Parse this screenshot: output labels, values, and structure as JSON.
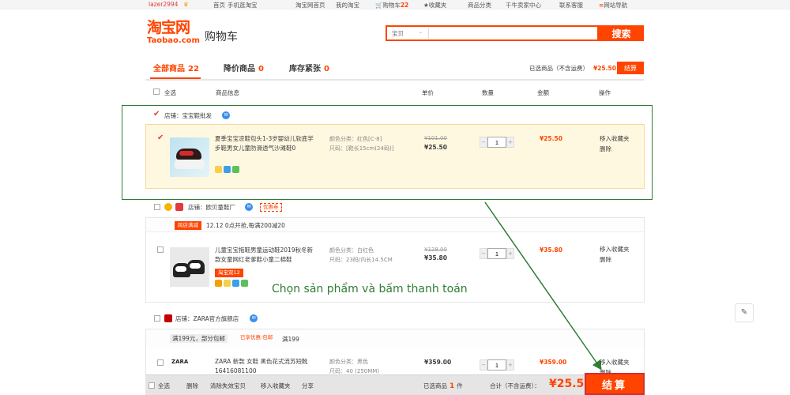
{
  "topbar": {
    "user": "lazer2994",
    "links": [
      "淘宝网首页",
      "我的淘宝",
      "购物车",
      "收藏夹",
      "商品分类",
      "千牛卖家中心",
      "联系客服",
      "网站导航"
    ],
    "mobile": "手机逛淘宝",
    "home": "首页",
    "cart_count": "22"
  },
  "header": {
    "logo_cn": "淘宝网",
    "logo_en": "Taobao.com",
    "cart_title": "购物车",
    "search_scope": "宝贝",
    "search_placeholder": "",
    "search_button": "搜索"
  },
  "tabs": [
    {
      "label": "全部商品",
      "count": "22"
    },
    {
      "label": "降价商品",
      "count": "0"
    },
    {
      "label": "库存紧张",
      "count": "0"
    }
  ],
  "summary": {
    "selected_label": "已选商品（不含运费）",
    "selected_amount": "¥25.50",
    "checkout_small": "结算"
  },
  "columns": {
    "select_all": "全选",
    "info": "商品信息",
    "unit_price": "单价",
    "quantity": "数量",
    "amount": "金额",
    "ops": "操作"
  },
  "shops": [
    {
      "name": "店铺：宝宝鞋批发",
      "item": {
        "title": "夏季宝宝凉鞋包头1-3岁婴幼儿软底学步鞋男女儿童防滑透气沙滩鞋0",
        "prop1": "颜色分类：红色[C-8]",
        "prop2": "尺码：[鞋长15cm(24码)]",
        "old_price": "¥101.00",
        "price": "¥25.50",
        "qty": "1",
        "subtotal": "¥25.50",
        "op1": "移入收藏夹",
        "op2": "删除"
      }
    },
    {
      "name": "店铺：欧贝童鞋厂",
      "coupon": "优惠券",
      "promo_tag": "跨店满减",
      "promo_text": "12.12 0点开抢,每满200减20",
      "item": {
        "title": "儿童宝宝拖鞋男童运动鞋2019秋冬新款女童网红老爹鞋小童二棉鞋",
        "prop1": "颜色分类：白红色",
        "prop2": "尺码：23码/内长14.5CM",
        "badge": "淘宝双12",
        "old_price": "¥128.00",
        "price": "¥35.80",
        "qty": "1",
        "subtotal": "¥35.80",
        "op1": "移入收藏夹",
        "op2": "删除"
      }
    },
    {
      "name": "店铺：ZARA官方旗舰店",
      "promo_text": "满199元，部分包邮",
      "discount": "已享优惠:包邮",
      "discount_rule": "满199",
      "item": {
        "brand": "ZARA",
        "title": "ZARA 新款 女鞋 黑色花式流苏短靴 16416081100",
        "prop1": "颜色分类：黑色",
        "prop2": "尺码：40 (250MM)",
        "price": "¥359.00",
        "qty": "1",
        "subtotal": "¥359.00",
        "op1": "移入收藏夹",
        "op2": "删除"
      }
    }
  ],
  "annotation": "Chọn sản phẩm và bấm thanh toán",
  "bottom": {
    "select_all": "全选",
    "delete": "删除",
    "clear_invalid": "清除失效宝贝",
    "move_fav": "移入收藏夹",
    "share": "分享",
    "selected_prefix": "已选商品",
    "selected_count": "1",
    "selected_suffix": "件",
    "total_label": "合计（不含运费）：",
    "total": "¥25.50",
    "checkout": "结算"
  },
  "colors": {
    "accent": "#ff4400",
    "annotation": "#2e7d32",
    "selected_row": "#fff8e1"
  }
}
